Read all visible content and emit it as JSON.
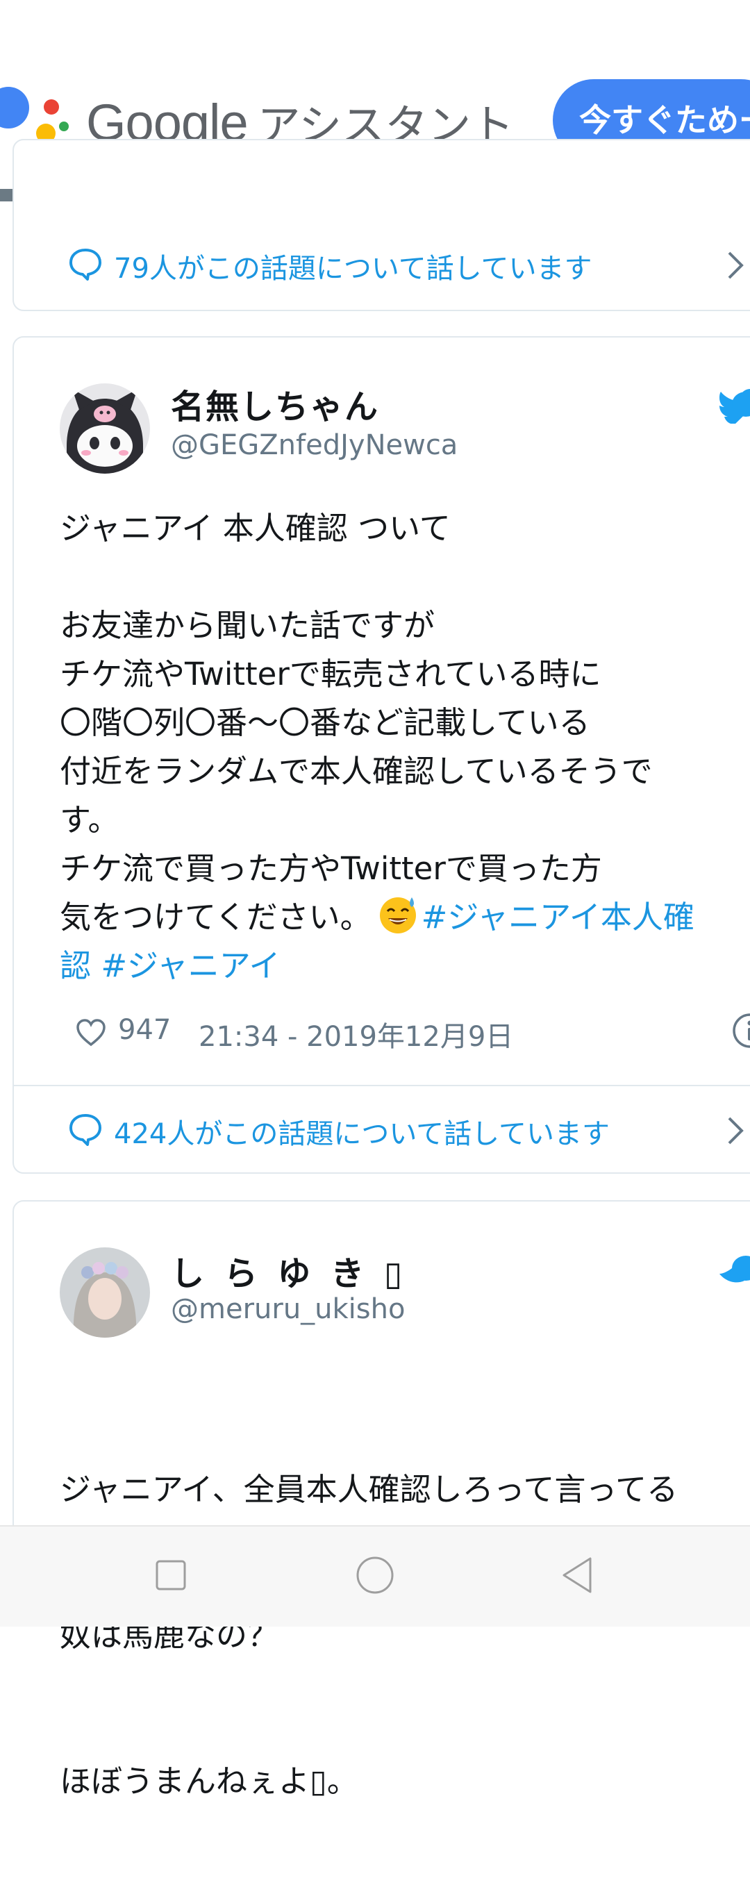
{
  "ad": {
    "brand": "Google",
    "product": "アシスタント",
    "cta": "今すぐためー"
  },
  "colors": {
    "link": "#1b95e0",
    "ad_button": "#4285f4",
    "collapse_tab": "#607d8b"
  },
  "cards": [
    {
      "talk_text": "79人がこの話題について話しています"
    },
    {
      "display_name": "名無しちゃん",
      "handle": "@GEGZnfedJyNewca",
      "body_lines": [
        "ジャニアイ 本人確認 ついて",
        "",
        "お友達から聞いた話ですが",
        "チケ流やTwitterで転売されている時に",
        "〇階〇列〇番〜〇番など記載している",
        "付近をランダムで本人確認しているそうで",
        "す。",
        "チケ流で買った方やTwitterで買った方",
        "気をつけてください。"
      ],
      "hashtag1": "#ジャニアイ本人確",
      "hashtag1_cont": "認",
      "hashtag2": "#ジャニアイ",
      "likes": "947",
      "timestamp": "21:34 - 2019年12月9日",
      "talk_text": "424人がこの話題について話しています"
    },
    {
      "display_name": "し ら ゆ き ▯",
      "handle": "@meruru_ukisho",
      "body_lines": [
        "ジャニアイ、全員本人確認しろって言ってる",
        "奴は馬鹿なの？",
        "ほぼうまんねぇよ▯。"
      ]
    }
  ],
  "icons": [
    "speech-bubble-icon",
    "chevron-right-icon",
    "twitter-bird-icon",
    "heart-icon",
    "info-icon",
    "chevron-up-icon",
    "square-nav-icon",
    "circle-nav-icon",
    "triangle-back-icon",
    "grinning-sweat-emoji-icon"
  ]
}
